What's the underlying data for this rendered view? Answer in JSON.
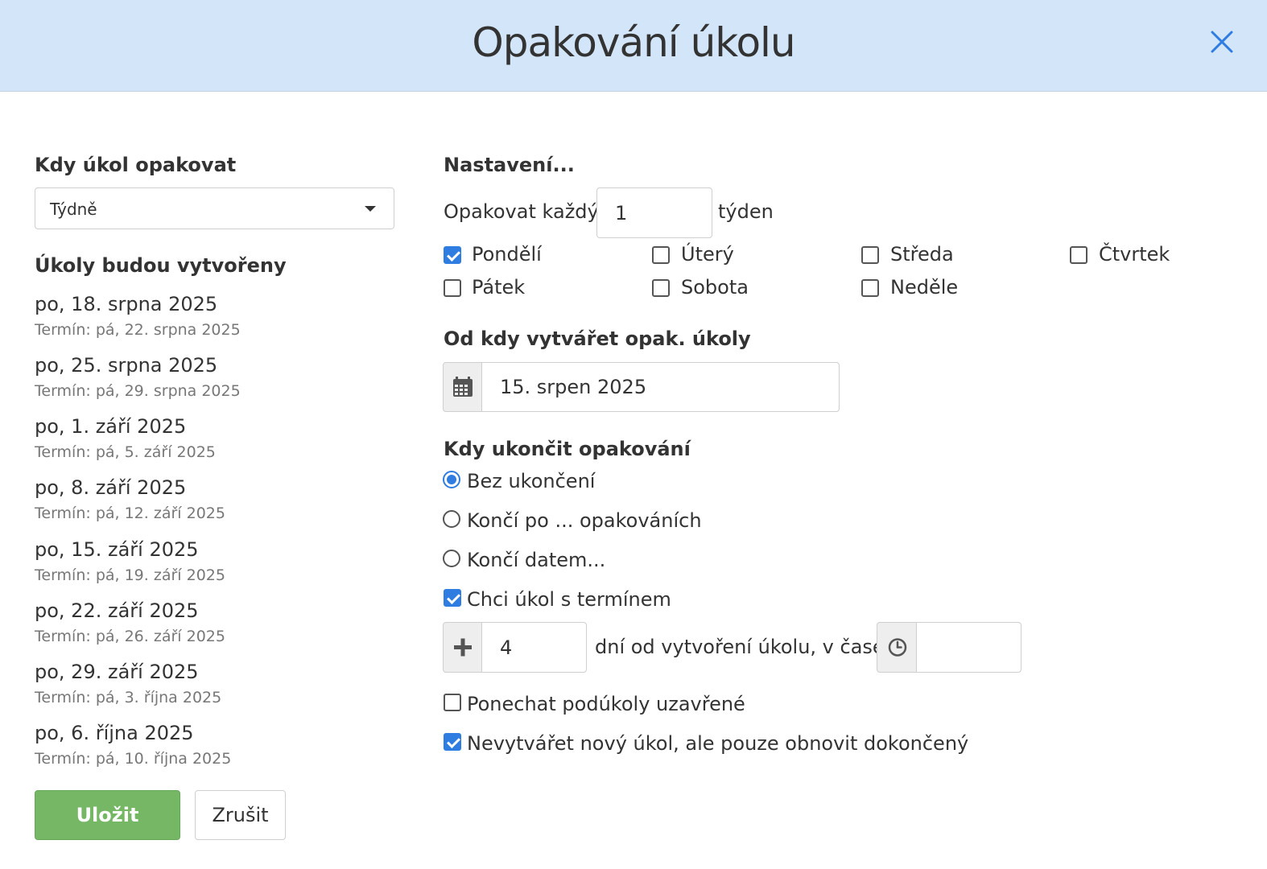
{
  "header": {
    "title": "Opakování úkolu"
  },
  "left": {
    "when_label": "Kdy úkol opakovat",
    "frequency_value": "Týdně",
    "created_label": "Úkoly budou vytvořeny",
    "occurrences": [
      {
        "date": "po, 18. srpna 2025",
        "due": "Termín: pá, 22. srpna 2025"
      },
      {
        "date": "po, 25. srpna 2025",
        "due": "Termín: pá, 29. srpna 2025"
      },
      {
        "date": "po, 1. září 2025",
        "due": "Termín: pá, 5. září 2025"
      },
      {
        "date": "po, 8. září 2025",
        "due": "Termín: pá, 12. září 2025"
      },
      {
        "date": "po, 15. září 2025",
        "due": "Termín: pá, 19. září 2025"
      },
      {
        "date": "po, 22. září 2025",
        "due": "Termín: pá, 26. září 2025"
      },
      {
        "date": "po, 29. září 2025",
        "due": "Termín: pá, 3. října 2025"
      },
      {
        "date": "po, 6. října 2025",
        "due": "Termín: pá, 10. října 2025"
      }
    ]
  },
  "right": {
    "settings_label": "Nastavení...",
    "repeat_every_label": "Opakovat každý",
    "repeat_every_value": "1",
    "repeat_unit": "týden",
    "days": [
      {
        "label": "Pondělí",
        "checked": true
      },
      {
        "label": "Úterý",
        "checked": false
      },
      {
        "label": "Středa",
        "checked": false
      },
      {
        "label": "Čtvrtek",
        "checked": false
      },
      {
        "label": "Pátek",
        "checked": false
      },
      {
        "label": "Sobota",
        "checked": false
      },
      {
        "label": "Neděle",
        "checked": false
      }
    ],
    "start_label": "Od kdy vytvářet opak. úkoly",
    "start_date": "15. srpen 2025",
    "end_label": "Kdy ukončit opakování",
    "end_options": [
      {
        "label": "Bez ukončení",
        "checked": true
      },
      {
        "label": "Končí po ... opakováních",
        "checked": false
      },
      {
        "label": "Končí datem...",
        "checked": false
      }
    ],
    "want_due": {
      "label": "Chci úkol s termínem",
      "checked": true
    },
    "due_days_value": "4",
    "due_days_text": "dní od vytvoření úkolu, v čase",
    "due_time_value": "",
    "keep_subtasks": {
      "label": "Ponechat podúkoly uzavřené",
      "checked": false
    },
    "no_new_task": {
      "label": "Nevytvářet nový úkol, ale pouze obnovit dokončený",
      "checked": true
    }
  },
  "actions": {
    "save_label": "Uložit",
    "cancel_label": "Zrušit"
  },
  "colors": {
    "header_bg": "#d3e5f8",
    "accent": "#2f7de1",
    "save_bg": "#76b766"
  }
}
